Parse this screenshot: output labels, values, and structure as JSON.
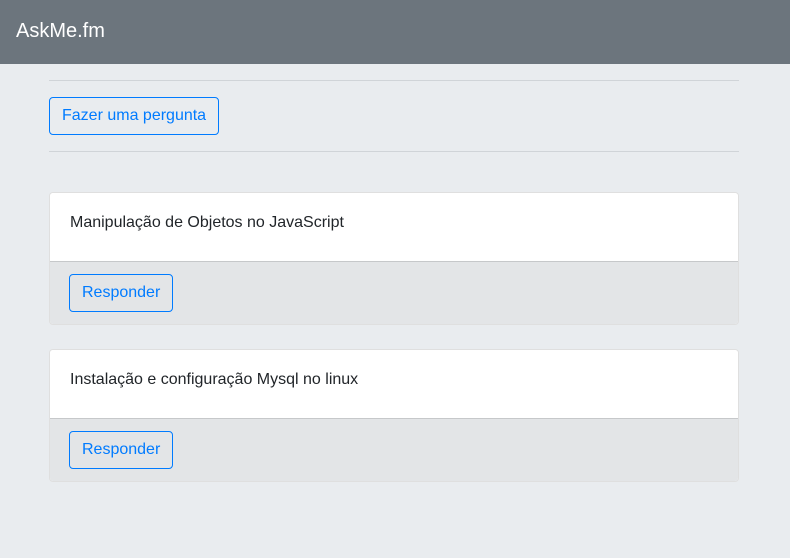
{
  "navbar": {
    "brand": "AskMe.fm"
  },
  "main": {
    "ask_button_label": "Fazer uma pergunta",
    "questions": [
      {
        "title": "Manipulação de Objetos no JavaScript",
        "reply_label": "Responder"
      },
      {
        "title": "Instalação e configuração Mysql no linux",
        "reply_label": "Responder"
      }
    ]
  },
  "colors": {
    "navbar_bg": "#6c757d",
    "page_bg": "#e9ecef",
    "primary": "#007bff",
    "card_footer_bg": "#e3e5e7"
  }
}
